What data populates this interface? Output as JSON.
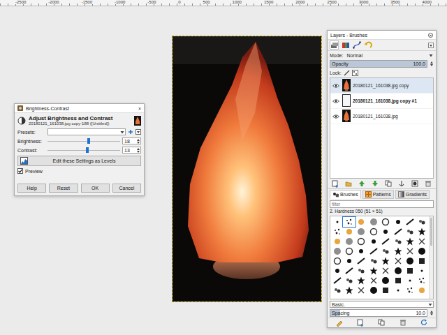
{
  "ruler": {
    "labels": [
      "-2500",
      "-2000",
      "-1500",
      "-1000",
      "-500",
      "0",
      "500",
      "1000",
      "1500",
      "2000",
      "2500",
      "3000",
      "3500",
      "4000"
    ]
  },
  "dialog": {
    "title": "Brightness-Contrast",
    "close": "×",
    "heading": "Adjust Brightness and Contrast",
    "subtitle": "20180121_161038.jpg copy-188 ([Untitled])",
    "presets_label": "Presets:",
    "sliders": [
      {
        "label": "Brightness:",
        "value": "18",
        "level": 0.57
      },
      {
        "label": "Contrast:",
        "value": "13",
        "level": 0.55
      }
    ],
    "levels_button": "Edit these Settings as Levels",
    "preview": {
      "label": "Preview",
      "checked": true
    },
    "buttons": [
      "Help",
      "Reset",
      "OK",
      "Cancel"
    ]
  },
  "dock": {
    "title": "Layers - Brushes",
    "mode_label": "Mode:",
    "mode_value": "Normal",
    "opacity": {
      "label": "Opacity",
      "value": "100.0",
      "level": 1
    },
    "lock_label": "Lock:",
    "layers": [
      {
        "name": "20180121_161038.jpg copy",
        "selected": true,
        "visible": true,
        "bold": false,
        "kind": "photo"
      },
      {
        "name": "20180121_161038.jpg copy #1",
        "selected": false,
        "visible": true,
        "bold": true,
        "kind": "blank"
      },
      {
        "name": "20180121_161038.jpg",
        "selected": false,
        "visible": true,
        "bold": false,
        "kind": "photo"
      }
    ],
    "brush_tabs": [
      {
        "label": "Brushes",
        "selected": true
      },
      {
        "label": "Patterns",
        "selected": false
      },
      {
        "label": "Gradients",
        "selected": false
      }
    ],
    "filter_placeholder": "filter",
    "brush_name": "2. Hardness 050 (51 × 51)",
    "brush_set": "Basic.",
    "spacing": {
      "label": "Spacing",
      "value": "10.0",
      "level": 0.1
    }
  }
}
